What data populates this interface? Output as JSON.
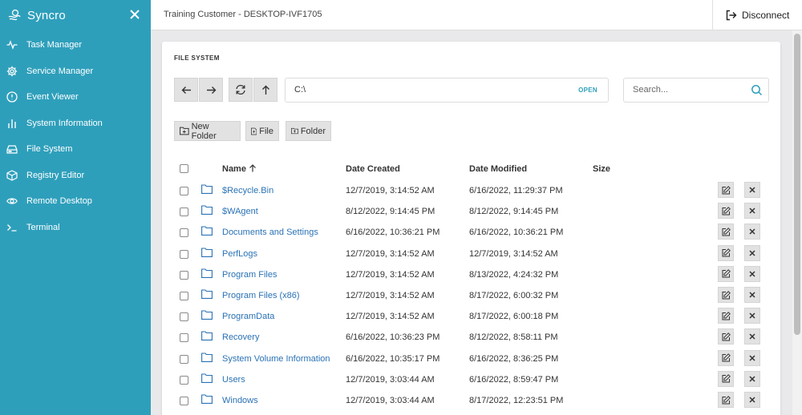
{
  "app": {
    "name": "Syncro"
  },
  "sidebar": {
    "items": [
      {
        "label": "Task Manager",
        "icon": "activity-icon"
      },
      {
        "label": "Service Manager",
        "icon": "gear-icon"
      },
      {
        "label": "Event Viewer",
        "icon": "alert-circle-icon"
      },
      {
        "label": "System Information",
        "icon": "bar-chart-icon"
      },
      {
        "label": "File System",
        "icon": "hard-drive-icon"
      },
      {
        "label": "Registry Editor",
        "icon": "cube-icon"
      },
      {
        "label": "Remote Desktop",
        "icon": "eye-icon"
      },
      {
        "label": "Terminal",
        "icon": "terminal-icon"
      }
    ]
  },
  "header": {
    "title": "Training Customer - DESKTOP-IVF1705",
    "disconnect_label": "Disconnect"
  },
  "file_system": {
    "title": "FILE SYSTEM",
    "path": "C:\\",
    "open_label": "OPEN",
    "search_placeholder": "Search...",
    "actions": {
      "new_folder": "New Folder",
      "file": "File",
      "folder": "Folder"
    },
    "columns": {
      "name": "Name",
      "created": "Date Created",
      "modified": "Date Modified",
      "size": "Size"
    },
    "rows": [
      {
        "name": "$Recycle.Bin",
        "created": "12/7/2019, 3:14:52 AM",
        "modified": "6/16/2022, 11:29:37 PM",
        "size": ""
      },
      {
        "name": "$WAgent",
        "created": "8/12/2022, 9:14:45 PM",
        "modified": "8/12/2022, 9:14:45 PM",
        "size": ""
      },
      {
        "name": "Documents and Settings",
        "created": "6/16/2022, 10:36:21 PM",
        "modified": "6/16/2022, 10:36:21 PM",
        "size": ""
      },
      {
        "name": "PerfLogs",
        "created": "12/7/2019, 3:14:52 AM",
        "modified": "12/7/2019, 3:14:52 AM",
        "size": ""
      },
      {
        "name": "Program Files",
        "created": "12/7/2019, 3:14:52 AM",
        "modified": "8/13/2022, 4:24:32 PM",
        "size": ""
      },
      {
        "name": "Program Files (x86)",
        "created": "12/7/2019, 3:14:52 AM",
        "modified": "8/17/2022, 6:00:32 PM",
        "size": ""
      },
      {
        "name": "ProgramData",
        "created": "12/7/2019, 3:14:52 AM",
        "modified": "8/17/2022, 6:00:18 PM",
        "size": ""
      },
      {
        "name": "Recovery",
        "created": "6/16/2022, 10:36:23 PM",
        "modified": "8/12/2022, 8:58:11 PM",
        "size": ""
      },
      {
        "name": "System Volume Information",
        "created": "6/16/2022, 10:35:17 PM",
        "modified": "6/16/2022, 8:36:25 PM",
        "size": ""
      },
      {
        "name": "Users",
        "created": "12/7/2019, 3:03:44 AM",
        "modified": "6/16/2022, 8:59:47 PM",
        "size": ""
      },
      {
        "name": "Windows",
        "created": "12/7/2019, 3:03:44 AM",
        "modified": "8/17/2022, 12:23:51 PM",
        "size": ""
      }
    ]
  },
  "colors": {
    "sidebar": "#2e9fbb",
    "link": "#2a72b5",
    "accent": "#2e9fbb"
  }
}
